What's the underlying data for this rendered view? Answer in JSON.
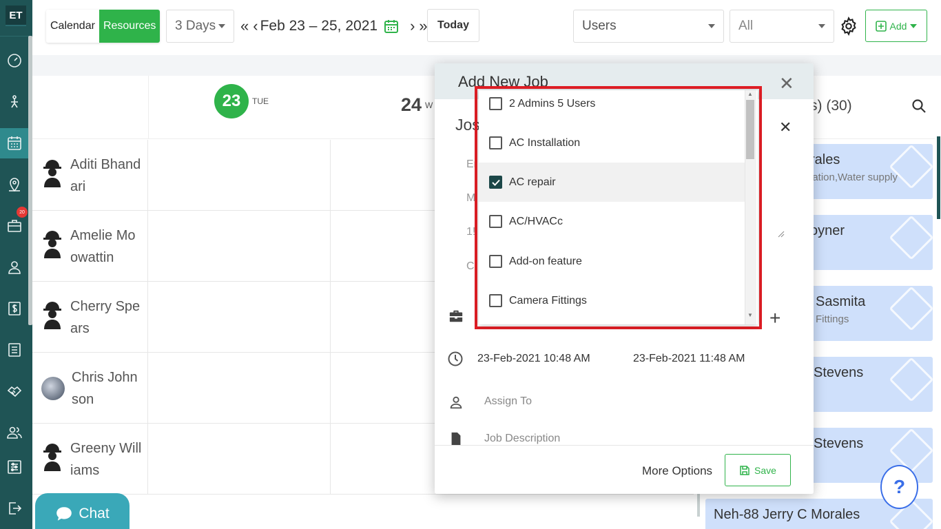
{
  "app": {
    "logo": "ET"
  },
  "nav": {
    "badge": "20"
  },
  "toolbar": {
    "view_calendar": "Calendar",
    "view_resources": "Resources",
    "range_select": "3 Days",
    "date_range": "Feb 23 – 25, 2021",
    "today": "Today",
    "filter_users": "Users",
    "filter_all": "All",
    "add": "Add",
    "colors": {
      "accent": "#2fb34a",
      "nav_bg": "#1f5455"
    }
  },
  "calendar": {
    "days": [
      {
        "num": "23",
        "name": "TUE"
      },
      {
        "num": "24",
        "name": "W"
      }
    ],
    "resources": [
      {
        "name": "Aditi Bhandari"
      },
      {
        "name": "Amelie Moowattin"
      },
      {
        "name": "Cherry Spears"
      },
      {
        "name": "Chris Johnson"
      },
      {
        "name": "Greeny Williams"
      }
    ]
  },
  "unassigned": {
    "title": "s) (30)",
    "jobs": [
      {
        "line1": "rales",
        "line2": "lation,Water supply"
      },
      {
        "line1": "oyner",
        "line2": ""
      },
      {
        "line1": "Sasmita",
        "line2": "Fittings"
      },
      {
        "line1": "Stevens",
        "line2": ""
      },
      {
        "line1": "Stevens",
        "line2": ""
      },
      {
        "line1": "Neh-88 Jerry C Morales",
        "line2": ""
      }
    ]
  },
  "modal": {
    "title": "Add New Job",
    "client_partial": "Jos",
    "hidden_fields": [
      "Er",
      "M",
      "1!",
      "Ci"
    ],
    "start": "23-Feb-2021 10:48 AM",
    "end": "23-Feb-2021 11:48 AM",
    "assign_placeholder": "Assign To",
    "desc_placeholder": "Job Description",
    "more_options": "More Options",
    "save": "Save"
  },
  "jobtype_dropdown": {
    "options": [
      {
        "label": "2 Admins 5 Users",
        "checked": false
      },
      {
        "label": "AC Installation",
        "checked": false
      },
      {
        "label": "AC repair",
        "checked": true
      },
      {
        "label": "AC/HVACc",
        "checked": false
      },
      {
        "label": "Add-on feature",
        "checked": false
      },
      {
        "label": "Camera Fittings",
        "checked": false
      }
    ]
  },
  "chat": {
    "label": "Chat"
  },
  "help": {
    "label": "?"
  }
}
